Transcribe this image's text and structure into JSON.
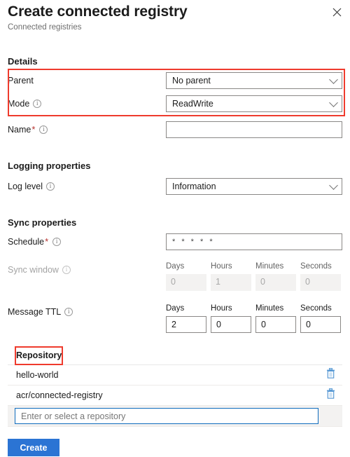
{
  "header": {
    "title": "Create connected registry",
    "subtitle": "Connected registries",
    "close_icon": "close-icon"
  },
  "sections": {
    "details": "Details",
    "logging": "Logging properties",
    "sync": "Sync properties"
  },
  "fields": {
    "parent": {
      "label": "Parent",
      "value": "No parent"
    },
    "mode": {
      "label": "Mode",
      "value": "ReadWrite"
    },
    "name": {
      "label": "Name",
      "required": "*",
      "value": ""
    },
    "log_level": {
      "label": "Log level",
      "value": "Information"
    },
    "schedule": {
      "label": "Schedule",
      "required": "*",
      "value": "* * * * *"
    },
    "sync_window": {
      "label": "Sync window",
      "columns": [
        "Days",
        "Hours",
        "Minutes",
        "Seconds"
      ],
      "values": [
        "0",
        "1",
        "0",
        "0"
      ],
      "disabled": true
    },
    "message_ttl": {
      "label": "Message TTL",
      "columns": [
        "Days",
        "Hours",
        "Minutes",
        "Seconds"
      ],
      "values": [
        "2",
        "0",
        "0",
        "0"
      ],
      "disabled": false
    }
  },
  "repository": {
    "header": "Repository",
    "rows": [
      {
        "name": "hello-world",
        "delete_icon": "trash-icon"
      },
      {
        "name": "acr/connected-registry",
        "delete_icon": "trash-icon"
      }
    ],
    "input_placeholder": "Enter or select a repository",
    "input_value": ""
  },
  "actions": {
    "create_label": "Create"
  },
  "colors": {
    "accent": "#2b74d4",
    "highlight": "#ef3b2d",
    "required": "#b5302c",
    "trash": "#5b9bd5",
    "focus_border": "#0f6cbd"
  }
}
